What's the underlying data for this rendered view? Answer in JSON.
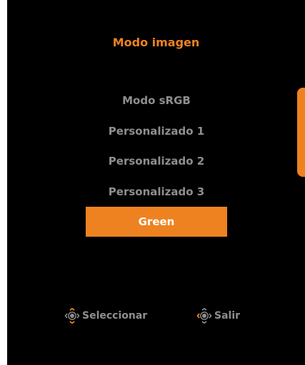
{
  "osd": {
    "title": "Modo imagen",
    "items": [
      {
        "label": "Modo sRGB",
        "selected": false
      },
      {
        "label": "Personalizado 1",
        "selected": false
      },
      {
        "label": "Personalizado 2",
        "selected": false
      },
      {
        "label": "Personalizado 3",
        "selected": false
      },
      {
        "label": "Green",
        "selected": true
      }
    ],
    "footer": {
      "select_label": "Seleccionar",
      "select_icon": "joystick-updown-icon",
      "exit_label": "Salir",
      "exit_icon": "joystick-press-icon"
    }
  },
  "colors": {
    "accent": "#ee8221",
    "background": "#000000",
    "text": "#8e8e8e",
    "selected_text": "#ffffff"
  }
}
